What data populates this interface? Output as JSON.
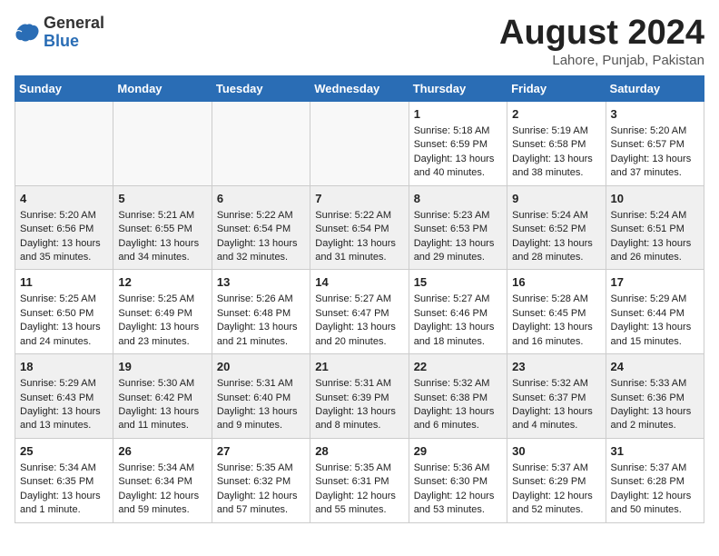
{
  "header": {
    "logo_general": "General",
    "logo_blue": "Blue",
    "month_title": "August 2024",
    "location": "Lahore, Punjab, Pakistan"
  },
  "days_of_week": [
    "Sunday",
    "Monday",
    "Tuesday",
    "Wednesday",
    "Thursday",
    "Friday",
    "Saturday"
  ],
  "weeks": [
    [
      {
        "day": "",
        "empty": true
      },
      {
        "day": "",
        "empty": true
      },
      {
        "day": "",
        "empty": true
      },
      {
        "day": "",
        "empty": true
      },
      {
        "day": "1",
        "sunrise": "5:18 AM",
        "sunset": "6:59 PM",
        "daylight": "13 hours and 40 minutes."
      },
      {
        "day": "2",
        "sunrise": "5:19 AM",
        "sunset": "6:58 PM",
        "daylight": "13 hours and 38 minutes."
      },
      {
        "day": "3",
        "sunrise": "5:20 AM",
        "sunset": "6:57 PM",
        "daylight": "13 hours and 37 minutes."
      }
    ],
    [
      {
        "day": "4",
        "sunrise": "5:20 AM",
        "sunset": "6:56 PM",
        "daylight": "13 hours and 35 minutes."
      },
      {
        "day": "5",
        "sunrise": "5:21 AM",
        "sunset": "6:55 PM",
        "daylight": "13 hours and 34 minutes."
      },
      {
        "day": "6",
        "sunrise": "5:22 AM",
        "sunset": "6:54 PM",
        "daylight": "13 hours and 32 minutes."
      },
      {
        "day": "7",
        "sunrise": "5:22 AM",
        "sunset": "6:54 PM",
        "daylight": "13 hours and 31 minutes."
      },
      {
        "day": "8",
        "sunrise": "5:23 AM",
        "sunset": "6:53 PM",
        "daylight": "13 hours and 29 minutes."
      },
      {
        "day": "9",
        "sunrise": "5:24 AM",
        "sunset": "6:52 PM",
        "daylight": "13 hours and 28 minutes."
      },
      {
        "day": "10",
        "sunrise": "5:24 AM",
        "sunset": "6:51 PM",
        "daylight": "13 hours and 26 minutes."
      }
    ],
    [
      {
        "day": "11",
        "sunrise": "5:25 AM",
        "sunset": "6:50 PM",
        "daylight": "13 hours and 24 minutes."
      },
      {
        "day": "12",
        "sunrise": "5:25 AM",
        "sunset": "6:49 PM",
        "daylight": "13 hours and 23 minutes."
      },
      {
        "day": "13",
        "sunrise": "5:26 AM",
        "sunset": "6:48 PM",
        "daylight": "13 hours and 21 minutes."
      },
      {
        "day": "14",
        "sunrise": "5:27 AM",
        "sunset": "6:47 PM",
        "daylight": "13 hours and 20 minutes."
      },
      {
        "day": "15",
        "sunrise": "5:27 AM",
        "sunset": "6:46 PM",
        "daylight": "13 hours and 18 minutes."
      },
      {
        "day": "16",
        "sunrise": "5:28 AM",
        "sunset": "6:45 PM",
        "daylight": "13 hours and 16 minutes."
      },
      {
        "day": "17",
        "sunrise": "5:29 AM",
        "sunset": "6:44 PM",
        "daylight": "13 hours and 15 minutes."
      }
    ],
    [
      {
        "day": "18",
        "sunrise": "5:29 AM",
        "sunset": "6:43 PM",
        "daylight": "13 hours and 13 minutes."
      },
      {
        "day": "19",
        "sunrise": "5:30 AM",
        "sunset": "6:42 PM",
        "daylight": "13 hours and 11 minutes."
      },
      {
        "day": "20",
        "sunrise": "5:31 AM",
        "sunset": "6:40 PM",
        "daylight": "13 hours and 9 minutes."
      },
      {
        "day": "21",
        "sunrise": "5:31 AM",
        "sunset": "6:39 PM",
        "daylight": "13 hours and 8 minutes."
      },
      {
        "day": "22",
        "sunrise": "5:32 AM",
        "sunset": "6:38 PM",
        "daylight": "13 hours and 6 minutes."
      },
      {
        "day": "23",
        "sunrise": "5:32 AM",
        "sunset": "6:37 PM",
        "daylight": "13 hours and 4 minutes."
      },
      {
        "day": "24",
        "sunrise": "5:33 AM",
        "sunset": "6:36 PM",
        "daylight": "13 hours and 2 minutes."
      }
    ],
    [
      {
        "day": "25",
        "sunrise": "5:34 AM",
        "sunset": "6:35 PM",
        "daylight": "13 hours and 1 minute."
      },
      {
        "day": "26",
        "sunrise": "5:34 AM",
        "sunset": "6:34 PM",
        "daylight": "12 hours and 59 minutes."
      },
      {
        "day": "27",
        "sunrise": "5:35 AM",
        "sunset": "6:32 PM",
        "daylight": "12 hours and 57 minutes."
      },
      {
        "day": "28",
        "sunrise": "5:35 AM",
        "sunset": "6:31 PM",
        "daylight": "12 hours and 55 minutes."
      },
      {
        "day": "29",
        "sunrise": "5:36 AM",
        "sunset": "6:30 PM",
        "daylight": "12 hours and 53 minutes."
      },
      {
        "day": "30",
        "sunrise": "5:37 AM",
        "sunset": "6:29 PM",
        "daylight": "12 hours and 52 minutes."
      },
      {
        "day": "31",
        "sunrise": "5:37 AM",
        "sunset": "6:28 PM",
        "daylight": "12 hours and 50 minutes."
      }
    ]
  ]
}
